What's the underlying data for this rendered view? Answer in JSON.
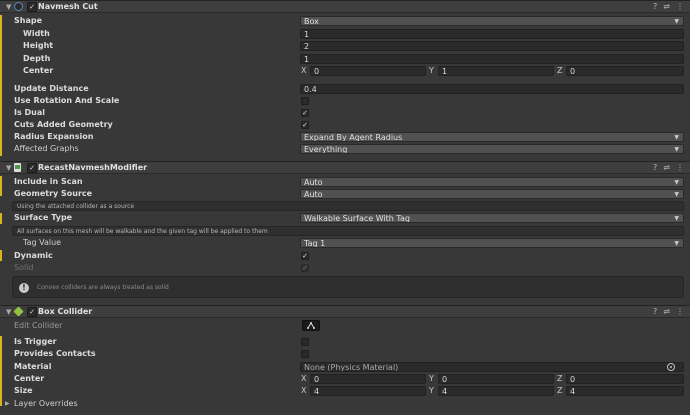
{
  "navmesh_cut": {
    "title": "Navmesh Cut",
    "shape_label": "Shape",
    "shape_value": "Box",
    "width_label": "Width",
    "width_value": "1",
    "height_label": "Height",
    "height_value": "2",
    "depth_label": "Depth",
    "depth_value": "1",
    "center_label": "Center",
    "center": {
      "x_label": "X",
      "x": "0",
      "y_label": "Y",
      "y": "1",
      "z_label": "Z",
      "z": "0"
    },
    "update_distance_label": "Update Distance",
    "update_distance_value": "0.4",
    "use_rotation_label": "Use Rotation And Scale",
    "is_dual_label": "Is Dual",
    "cuts_added_label": "Cuts Added Geometry",
    "radius_expansion_label": "Radius Expansion",
    "radius_expansion_value": "Expand By Agent Radius",
    "affected_graphs_label": "Affected Graphs",
    "affected_graphs_value": "Everything"
  },
  "recast_modifier": {
    "title": "RecastNavmeshModifier",
    "include_label": "Include in Scan",
    "include_value": "Auto",
    "geometry_label": "Geometry Source",
    "geometry_value": "Auto",
    "geometry_help": "Using the attached collider as a source",
    "surface_label": "Surface Type",
    "surface_value": "Walkable Surface With Tag",
    "surface_help": "All surfaces on this mesh will be walkable and the given tag will be applied to them",
    "tag_label": "Tag Value",
    "tag_value": "Tag 1",
    "dynamic_label": "Dynamic",
    "solid_label": "Solid",
    "convex_help": "Convex colliders are always treated as solid"
  },
  "box_collider": {
    "title": "Box Collider",
    "edit_label": "Edit Collider",
    "trigger_label": "Is Trigger",
    "contacts_label": "Provides Contacts",
    "material_label": "Material",
    "material_value": "None (Physics Material)",
    "center_label": "Center",
    "center": {
      "x_label": "X",
      "x": "0",
      "y_label": "Y",
      "y": "0",
      "z_label": "Z",
      "z": "0"
    },
    "size_label": "Size",
    "size": {
      "x_label": "X",
      "x": "4",
      "y_label": "Y",
      "y": "4",
      "z_label": "Z",
      "z": "4"
    },
    "layer_overrides_label": "Layer Overrides"
  },
  "colors": {
    "accent_bar": "#d8b420",
    "navmesh_icon": "#3b6fb3",
    "recast_icon": "#4e9a4a",
    "box_icon": "#8fc340"
  },
  "icons": [
    "fold-arrow-icon",
    "navmesh-cut-icon",
    "script-icon",
    "box-collider-icon",
    "help-icon",
    "presets-icon",
    "menu-icon",
    "info-icon",
    "edit-collider-icon",
    "object-picker-icon",
    "dropdown-arrow-icon"
  ]
}
